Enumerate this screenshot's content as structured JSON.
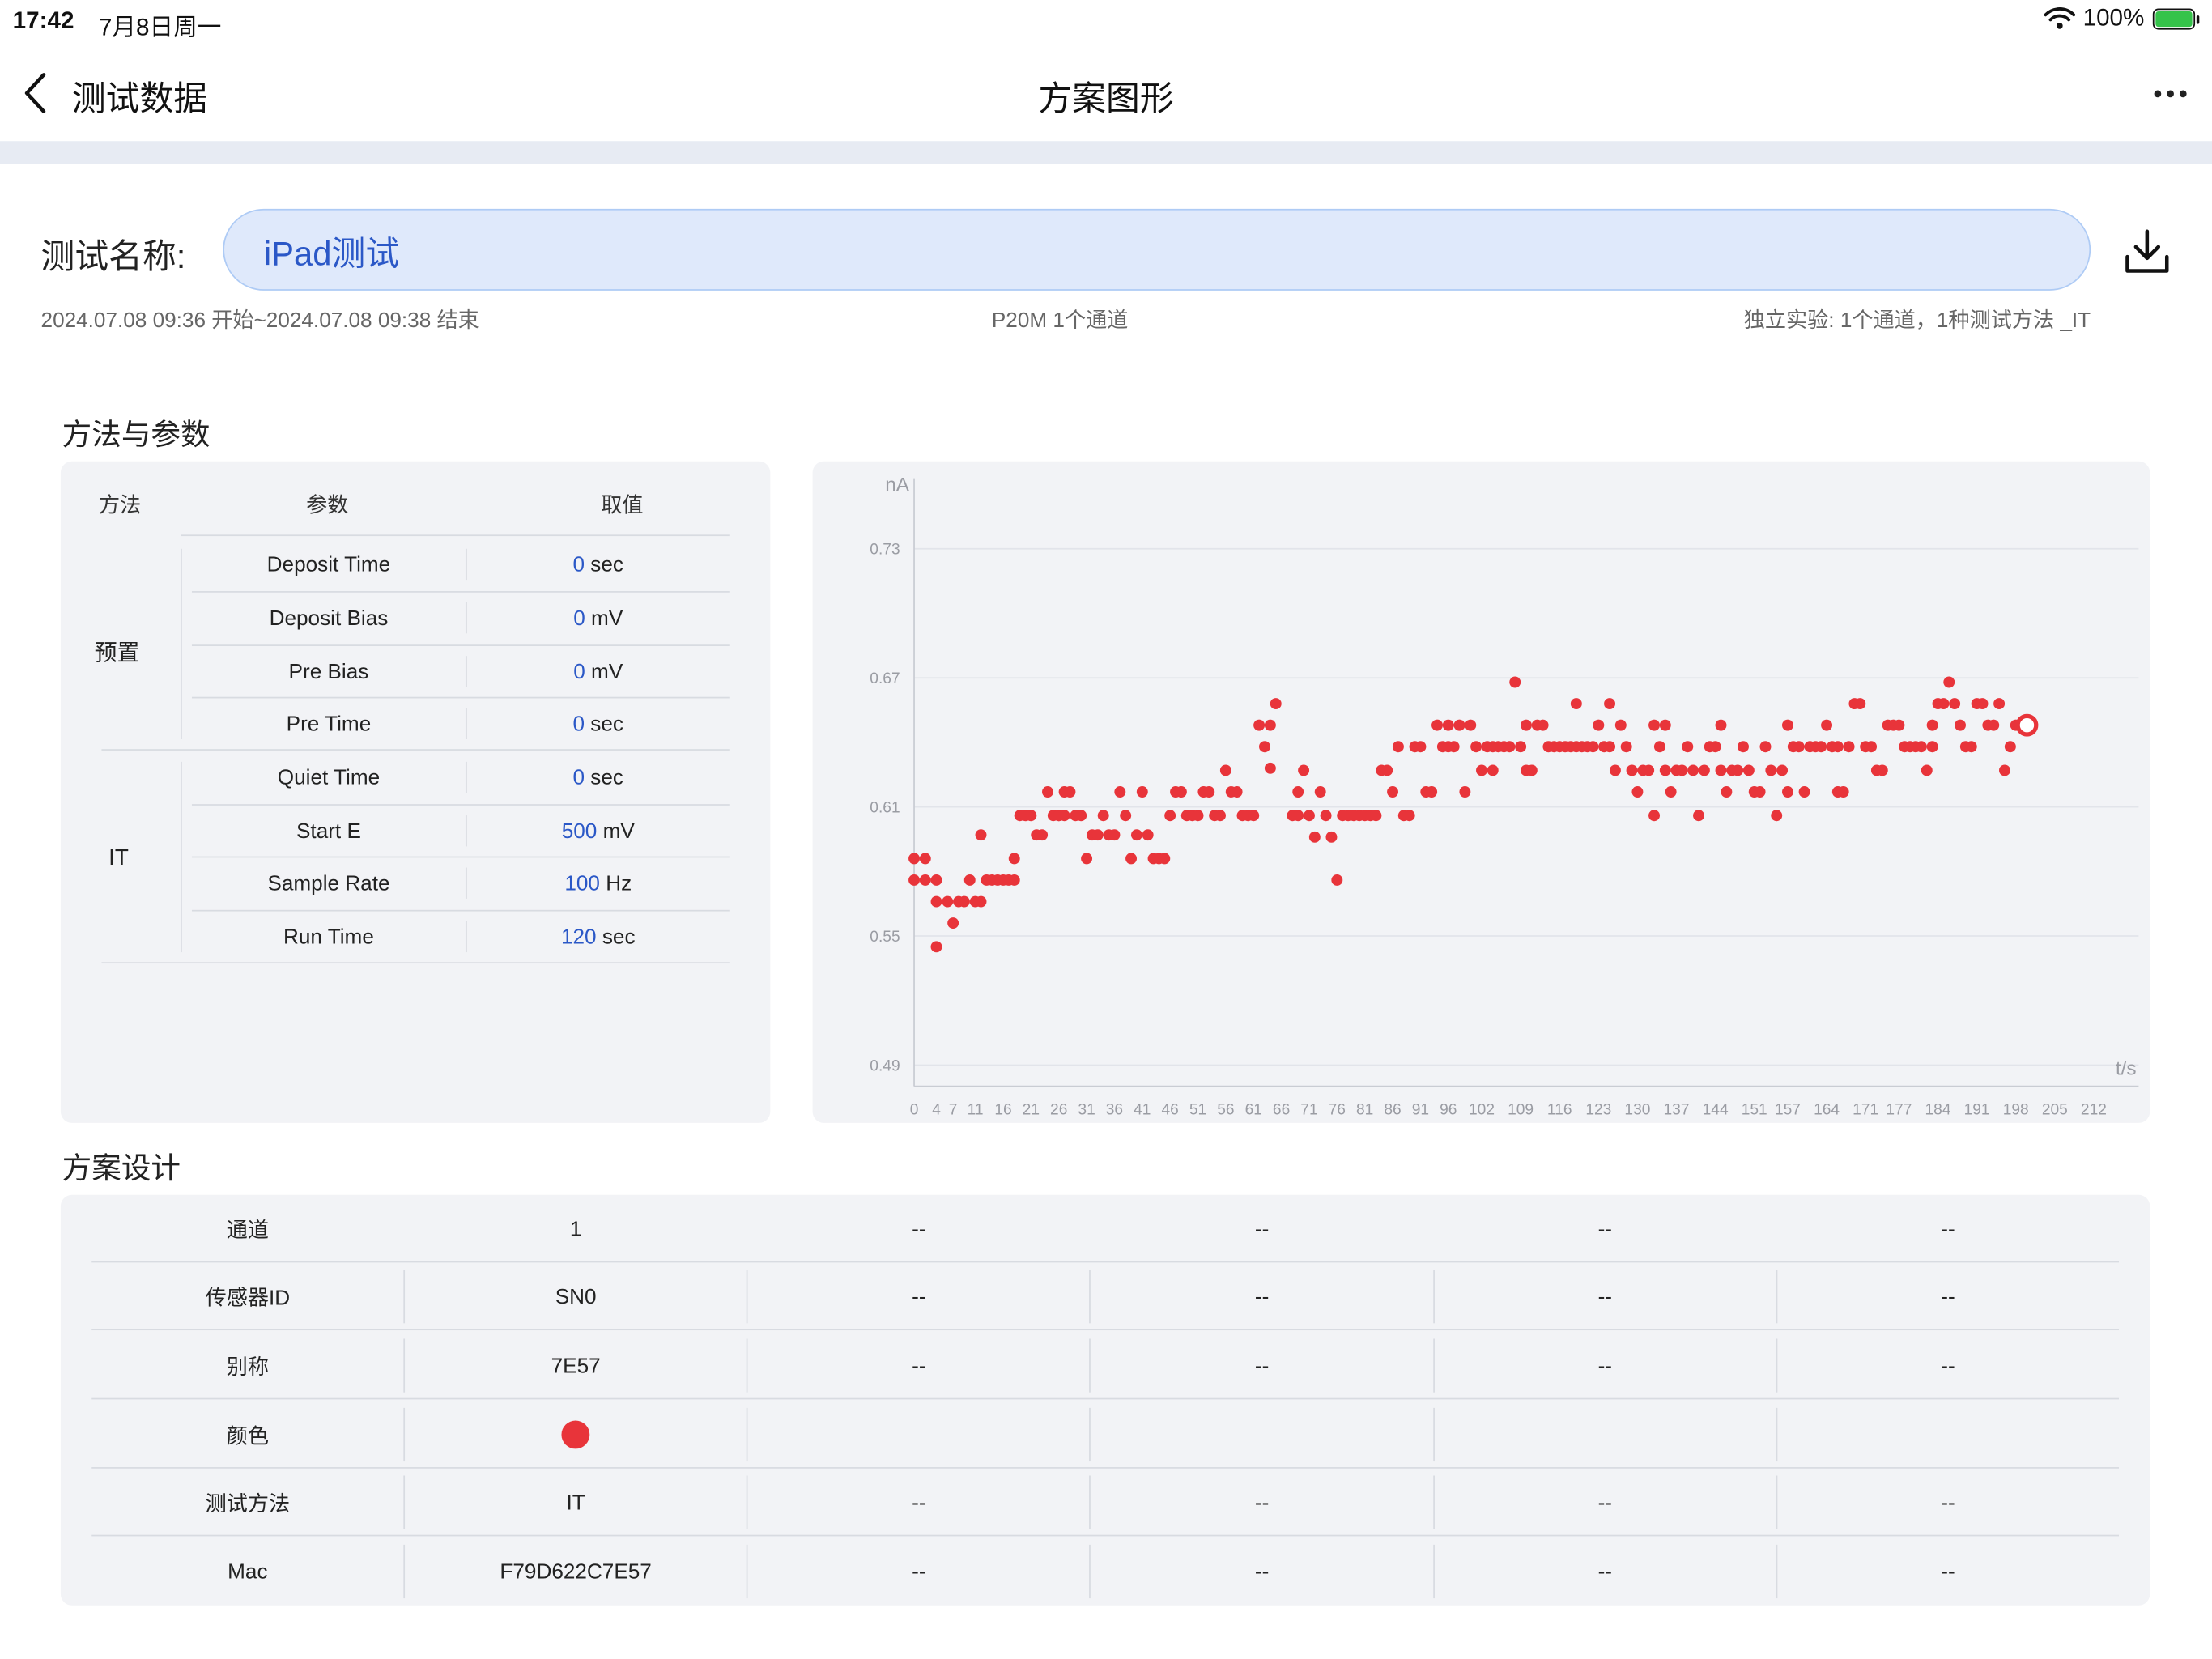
{
  "status_bar": {
    "time": "17:42",
    "date": "7月8日周一",
    "battery": "100%",
    "wifi_icon": "wifi-icon",
    "battery_icon": "battery-charging-icon"
  },
  "nav": {
    "back_label": "测试数据",
    "title": "方案图形",
    "more_icon": "ellipsis-icon"
  },
  "test": {
    "name_label": "测试名称:",
    "name_value": "iPad测试",
    "time_range": "2024.07.08 09:36 开始~2024.07.08 09:38 结束",
    "device": "P20M  1个通道",
    "experiment": "独立实验: 1个通道，1种测试方法 _IT"
  },
  "params": {
    "section_title": "方法与参数",
    "headers": {
      "method": "方法",
      "param": "参数",
      "value": "取值"
    },
    "groups": [
      {
        "method": "预置",
        "rows": [
          {
            "name": "Deposit Time",
            "value": "0",
            "unit": "sec"
          },
          {
            "name": "Deposit Bias",
            "value": "0",
            "unit": "mV"
          },
          {
            "name": "Pre Bias",
            "value": "0",
            "unit": "mV"
          },
          {
            "name": "Pre Time",
            "value": "0",
            "unit": "sec"
          }
        ]
      },
      {
        "method": "IT",
        "rows": [
          {
            "name": "Quiet Time",
            "value": "0",
            "unit": "sec"
          },
          {
            "name": "Start E",
            "value": "500",
            "unit": "mV"
          },
          {
            "name": "Sample Rate",
            "value": "100",
            "unit": "Hz"
          },
          {
            "name": "Run Time",
            "value": "120",
            "unit": "sec"
          }
        ]
      }
    ]
  },
  "chart_data": {
    "type": "scatter",
    "ylabel": "nA",
    "xlabel": "t/s",
    "y_ticks": [
      "0.73",
      "0.67",
      "0.61",
      "0.55",
      "0.49"
    ],
    "x_ticks": [
      "0",
      "4",
      "7",
      "11",
      "16",
      "21",
      "26",
      "31",
      "36",
      "41",
      "46",
      "51",
      "56",
      "61",
      "66",
      "71",
      "76",
      "81",
      "86",
      "91",
      "96",
      "102",
      "109",
      "116",
      "123",
      "130",
      "137",
      "144",
      "151",
      "157",
      "164",
      "171",
      "177",
      "184",
      "191",
      "198",
      "205",
      "212"
    ],
    "ylim": [
      0.49,
      0.73
    ],
    "xlim": [
      0,
      215
    ],
    "grid": true,
    "series": [
      {
        "color": "#e8343a",
        "points": [
          [
            0,
            0.586
          ],
          [
            2,
            0.586
          ],
          [
            0,
            0.576
          ],
          [
            2,
            0.576
          ],
          [
            4,
            0.576
          ],
          [
            4,
            0.566
          ],
          [
            6,
            0.566
          ],
          [
            4,
            0.545
          ],
          [
            7,
            0.556
          ],
          [
            8,
            0.566
          ],
          [
            9,
            0.566
          ],
          [
            10,
            0.576
          ],
          [
            11,
            0.566
          ],
          [
            12,
            0.566
          ],
          [
            13,
            0.576
          ],
          [
            14,
            0.576
          ],
          [
            15,
            0.576
          ],
          [
            16,
            0.576
          ],
          [
            17,
            0.576
          ],
          [
            18,
            0.576
          ],
          [
            12,
            0.597
          ],
          [
            18,
            0.586
          ],
          [
            19,
            0.606
          ],
          [
            20,
            0.606
          ],
          [
            21,
            0.606
          ],
          [
            22,
            0.597
          ],
          [
            23,
            0.597
          ],
          [
            24,
            0.617
          ],
          [
            25,
            0.606
          ],
          [
            26,
            0.606
          ],
          [
            27,
            0.617
          ],
          [
            26,
            0.606
          ],
          [
            27,
            0.606
          ],
          [
            28,
            0.617
          ],
          [
            29,
            0.606
          ],
          [
            30,
            0.606
          ],
          [
            31,
            0.586
          ],
          [
            32,
            0.597
          ],
          [
            33,
            0.597
          ],
          [
            34,
            0.606
          ],
          [
            35,
            0.597
          ],
          [
            36,
            0.597
          ],
          [
            37,
            0.617
          ],
          [
            38,
            0.606
          ],
          [
            39,
            0.586
          ],
          [
            40,
            0.597
          ],
          [
            41,
            0.617
          ],
          [
            42,
            0.597
          ],
          [
            43,
            0.586
          ],
          [
            44,
            0.586
          ],
          [
            45,
            0.586
          ],
          [
            46,
            0.606
          ],
          [
            47,
            0.617
          ],
          [
            48,
            0.617
          ],
          [
            49,
            0.606
          ],
          [
            50,
            0.606
          ],
          [
            51,
            0.606
          ],
          [
            52,
            0.617
          ],
          [
            53,
            0.617
          ],
          [
            54,
            0.606
          ],
          [
            55,
            0.606
          ],
          [
            56,
            0.627
          ],
          [
            57,
            0.617
          ],
          [
            58,
            0.617
          ],
          [
            59,
            0.606
          ],
          [
            60,
            0.606
          ],
          [
            61,
            0.606
          ],
          [
            62,
            0.648
          ],
          [
            63,
            0.638
          ],
          [
            64,
            0.628
          ],
          [
            64,
            0.648
          ],
          [
            65,
            0.658
          ],
          [
            68,
            0.606
          ],
          [
            69,
            0.606
          ],
          [
            69,
            0.617
          ],
          [
            70,
            0.627
          ],
          [
            71,
            0.606
          ],
          [
            72,
            0.596
          ],
          [
            73,
            0.617
          ],
          [
            74,
            0.606
          ],
          [
            75,
            0.596
          ],
          [
            76,
            0.576
          ],
          [
            77,
            0.606
          ],
          [
            78,
            0.606
          ],
          [
            79,
            0.606
          ],
          [
            80,
            0.606
          ],
          [
            81,
            0.606
          ],
          [
            82,
            0.606
          ],
          [
            83,
            0.606
          ],
          [
            84,
            0.627
          ],
          [
            85,
            0.627
          ],
          [
            86,
            0.617
          ],
          [
            87,
            0.638
          ],
          [
            88,
            0.606
          ],
          [
            89,
            0.606
          ],
          [
            90,
            0.638
          ],
          [
            91,
            0.638
          ],
          [
            92,
            0.617
          ],
          [
            93,
            0.617
          ],
          [
            94,
            0.648
          ],
          [
            95,
            0.638
          ],
          [
            96,
            0.638
          ],
          [
            96,
            0.648
          ],
          [
            97,
            0.638
          ],
          [
            98,
            0.648
          ],
          [
            99,
            0.617
          ],
          [
            100,
            0.648
          ],
          [
            101,
            0.638
          ],
          [
            102,
            0.627
          ],
          [
            103,
            0.638
          ],
          [
            104,
            0.638
          ],
          [
            104,
            0.627
          ],
          [
            105,
            0.638
          ],
          [
            106,
            0.638
          ],
          [
            107,
            0.638
          ],
          [
            108,
            0.668
          ],
          [
            109,
            0.638
          ],
          [
            110,
            0.648
          ],
          [
            110,
            0.627
          ],
          [
            111,
            0.627
          ],
          [
            112,
            0.648
          ],
          [
            113,
            0.648
          ],
          [
            114,
            0.638
          ],
          [
            115,
            0.638
          ],
          [
            116,
            0.638
          ],
          [
            117,
            0.638
          ],
          [
            118,
            0.638
          ],
          [
            119,
            0.658
          ],
          [
            119,
            0.638
          ],
          [
            120,
            0.638
          ],
          [
            121,
            0.638
          ],
          [
            122,
            0.638
          ],
          [
            123,
            0.648
          ],
          [
            124,
            0.638
          ],
          [
            125,
            0.658
          ],
          [
            125,
            0.638
          ],
          [
            126,
            0.627
          ],
          [
            127,
            0.648
          ],
          [
            128,
            0.638
          ],
          [
            129,
            0.627
          ],
          [
            130,
            0.617
          ],
          [
            131,
            0.627
          ],
          [
            132,
            0.627
          ],
          [
            133,
            0.648
          ],
          [
            133,
            0.606
          ],
          [
            134,
            0.638
          ],
          [
            135,
            0.627
          ],
          [
            135,
            0.648
          ],
          [
            136,
            0.617
          ],
          [
            137,
            0.627
          ],
          [
            138,
            0.627
          ],
          [
            139,
            0.638
          ],
          [
            140,
            0.627
          ],
          [
            141,
            0.606
          ],
          [
            142,
            0.627
          ],
          [
            143,
            0.638
          ],
          [
            144,
            0.638
          ],
          [
            145,
            0.648
          ],
          [
            145,
            0.627
          ],
          [
            146,
            0.617
          ],
          [
            147,
            0.627
          ],
          [
            148,
            0.627
          ],
          [
            149,
            0.638
          ],
          [
            150,
            0.627
          ],
          [
            151,
            0.617
          ],
          [
            152,
            0.617
          ],
          [
            153,
            0.638
          ],
          [
            154,
            0.627
          ],
          [
            155,
            0.606
          ],
          [
            156,
            0.627
          ],
          [
            157,
            0.617
          ],
          [
            157,
            0.648
          ],
          [
            158,
            0.638
          ],
          [
            159,
            0.638
          ],
          [
            160,
            0.617
          ],
          [
            161,
            0.638
          ],
          [
            162,
            0.638
          ],
          [
            163,
            0.638
          ],
          [
            164,
            0.648
          ],
          [
            165,
            0.638
          ],
          [
            166,
            0.617
          ],
          [
            166,
            0.638
          ],
          [
            167,
            0.617
          ],
          [
            168,
            0.638
          ],
          [
            169,
            0.658
          ],
          [
            170,
            0.658
          ],
          [
            171,
            0.638
          ],
          [
            172,
            0.638
          ],
          [
            173,
            0.627
          ],
          [
            174,
            0.627
          ],
          [
            175,
            0.648
          ],
          [
            176,
            0.648
          ],
          [
            177,
            0.648
          ],
          [
            178,
            0.638
          ],
          [
            179,
            0.638
          ],
          [
            180,
            0.638
          ],
          [
            181,
            0.638
          ],
          [
            182,
            0.627
          ],
          [
            183,
            0.638
          ],
          [
            183,
            0.648
          ],
          [
            184,
            0.658
          ],
          [
            185,
            0.658
          ],
          [
            186,
            0.668
          ],
          [
            187,
            0.658
          ],
          [
            188,
            0.648
          ],
          [
            189,
            0.638
          ],
          [
            190,
            0.638
          ],
          [
            191,
            0.658
          ],
          [
            192,
            0.658
          ],
          [
            193,
            0.648
          ],
          [
            194,
            0.648
          ],
          [
            195,
            0.658
          ],
          [
            196,
            0.627
          ],
          [
            197,
            0.638
          ],
          [
            198,
            0.648
          ],
          [
            199,
            0.648
          ]
        ],
        "last_point": [
          200,
          0.648
        ]
      }
    ]
  },
  "design": {
    "section_title": "方案设计",
    "rows": [
      {
        "label": "通道",
        "values": [
          "1",
          "--",
          "--",
          "--",
          "--"
        ]
      },
      {
        "label": "传感器ID",
        "values": [
          "SN0",
          "--",
          "--",
          "--",
          "--"
        ]
      },
      {
        "label": "别称",
        "values": [
          "7E57",
          "--",
          "--",
          "--",
          "--"
        ]
      },
      {
        "label": "颜色",
        "values": [
          "",
          "",
          "",
          "",
          ""
        ],
        "color": "#e8343a"
      },
      {
        "label": "测试方法",
        "values": [
          "IT",
          "--",
          "--",
          "--",
          "--"
        ]
      },
      {
        "label": "Mac",
        "values": [
          "F79D622C7E57",
          "--",
          "--",
          "--",
          "--"
        ]
      }
    ]
  }
}
